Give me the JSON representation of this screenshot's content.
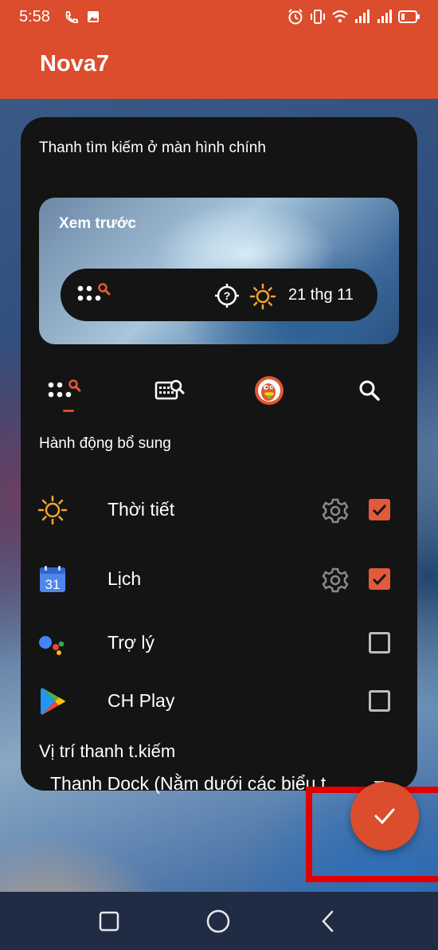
{
  "status_bar": {
    "time": "5:58",
    "left_icons": [
      "wifi-call-icon",
      "image-icon"
    ],
    "right_icons": [
      "alarm-icon",
      "vibrate-icon",
      "wifi-icon",
      "signal-icon",
      "signal-icon",
      "battery-icon"
    ]
  },
  "app": {
    "title": "Nova7"
  },
  "card": {
    "title": "Thanh tìm kiếm ở màn hình chính",
    "preview": {
      "label": "Xem trước",
      "date": "21 thg 11"
    },
    "tabs": [
      {
        "name": "dots-search-icon",
        "selected": true
      },
      {
        "name": "keyboard-search-icon",
        "selected": false
      },
      {
        "name": "duckduckgo-icon",
        "selected": false
      },
      {
        "name": "search-icon",
        "selected": false
      }
    ],
    "extra_actions": {
      "title": "Hành động bổ sung",
      "items": [
        {
          "label": "Thời tiết",
          "icon": "sun-icon",
          "has_settings": true,
          "checked": true
        },
        {
          "label": "Lịch",
          "icon": "calendar-icon",
          "calendar_number": "31",
          "has_settings": true,
          "checked": true
        },
        {
          "label": "Trợ lý",
          "icon": "google-assistant-icon",
          "has_settings": false,
          "checked": false
        },
        {
          "label": "CH Play",
          "icon": "play-store-icon",
          "has_settings": false,
          "checked": false
        }
      ]
    },
    "position": {
      "label": "Vị trí thanh t.kiếm",
      "value": "Thanh Dock (Nằm dưới các biểu t"
    }
  },
  "colors": {
    "accent": "#db4d2c",
    "checkbox_on": "#e35a3a",
    "card_bg": "#141414",
    "highlight": "#e00000"
  }
}
